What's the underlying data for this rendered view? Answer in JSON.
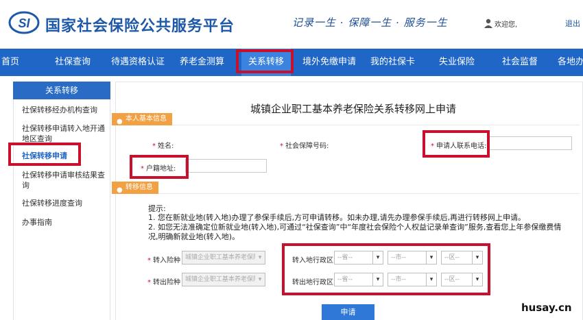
{
  "header": {
    "logo_text": "SI",
    "site_title": "国家社会保险公共服务平台",
    "slogan": "记录一生 · 保障一生 · 服务一生",
    "welcome": "欢迎您,",
    "logout": "退出"
  },
  "nav": {
    "items": [
      {
        "label": "首页"
      },
      {
        "label": "社保查询"
      },
      {
        "label": "待遇资格认证"
      },
      {
        "label": "养老金测算"
      },
      {
        "label": "关系转移",
        "active": true
      },
      {
        "label": "境外免缴申请"
      },
      {
        "label": "我的社保卡"
      },
      {
        "label": "失业保险"
      },
      {
        "label": "社会监督"
      },
      {
        "label": "各地办"
      }
    ]
  },
  "sidebar": {
    "title": "关系转移",
    "items": [
      {
        "label": "社保转移经办机构查询"
      },
      {
        "label": "社保转移申请转入地开通地区查询"
      },
      {
        "label": "社保转移申请",
        "active": true
      },
      {
        "label": "社保转移申请审核结果查询"
      },
      {
        "label": "社保转移进度查询"
      },
      {
        "label": "办事指南"
      }
    ]
  },
  "form": {
    "title": "城镇企业职工基本养老保险关系转移网上申请",
    "section_personal": "本人基本信息",
    "section_transfer": "转移信息",
    "name_label": "姓名:",
    "ssn_label": "社会保障号码:",
    "phone_label": "申请人联系电话:",
    "address_label": "户籍地址:",
    "tips_head": "提示:",
    "tips": [
      "1. 您在新就业地(转入地)办理了参保手续后,方可申请转移。如未办理,请先办理参保手续后,再进行转移网上申请。",
      "2. 如您无法准确定位新就业地(转入地),可通过“社保查询”中“年度社会保险个人权益记录单查询”服务,查看您上年参保缴费情",
      "况,明确新就业地(转入地)。"
    ],
    "transfer_in_type_label": "转入险种",
    "transfer_out_type_label": "转出险种",
    "insurance_type_value": "城镇企业职工基本养老保险",
    "transfer_in_region_label": "转入地行政区",
    "transfer_out_region_label": "转出地行政区",
    "province_placeholder": "--省--",
    "city_placeholder": "--市--",
    "district_placeholder": "--区--",
    "apply_button": "申请"
  },
  "watermark": "husay.cn",
  "colors": {
    "brand_blue": "#1f66c7",
    "highlight_red": "#c8102e",
    "section_orange": "#f2a044"
  },
  "icons": {
    "user": "user-icon",
    "logo": "si-logo",
    "dropdown": "chevron-down-icon"
  }
}
